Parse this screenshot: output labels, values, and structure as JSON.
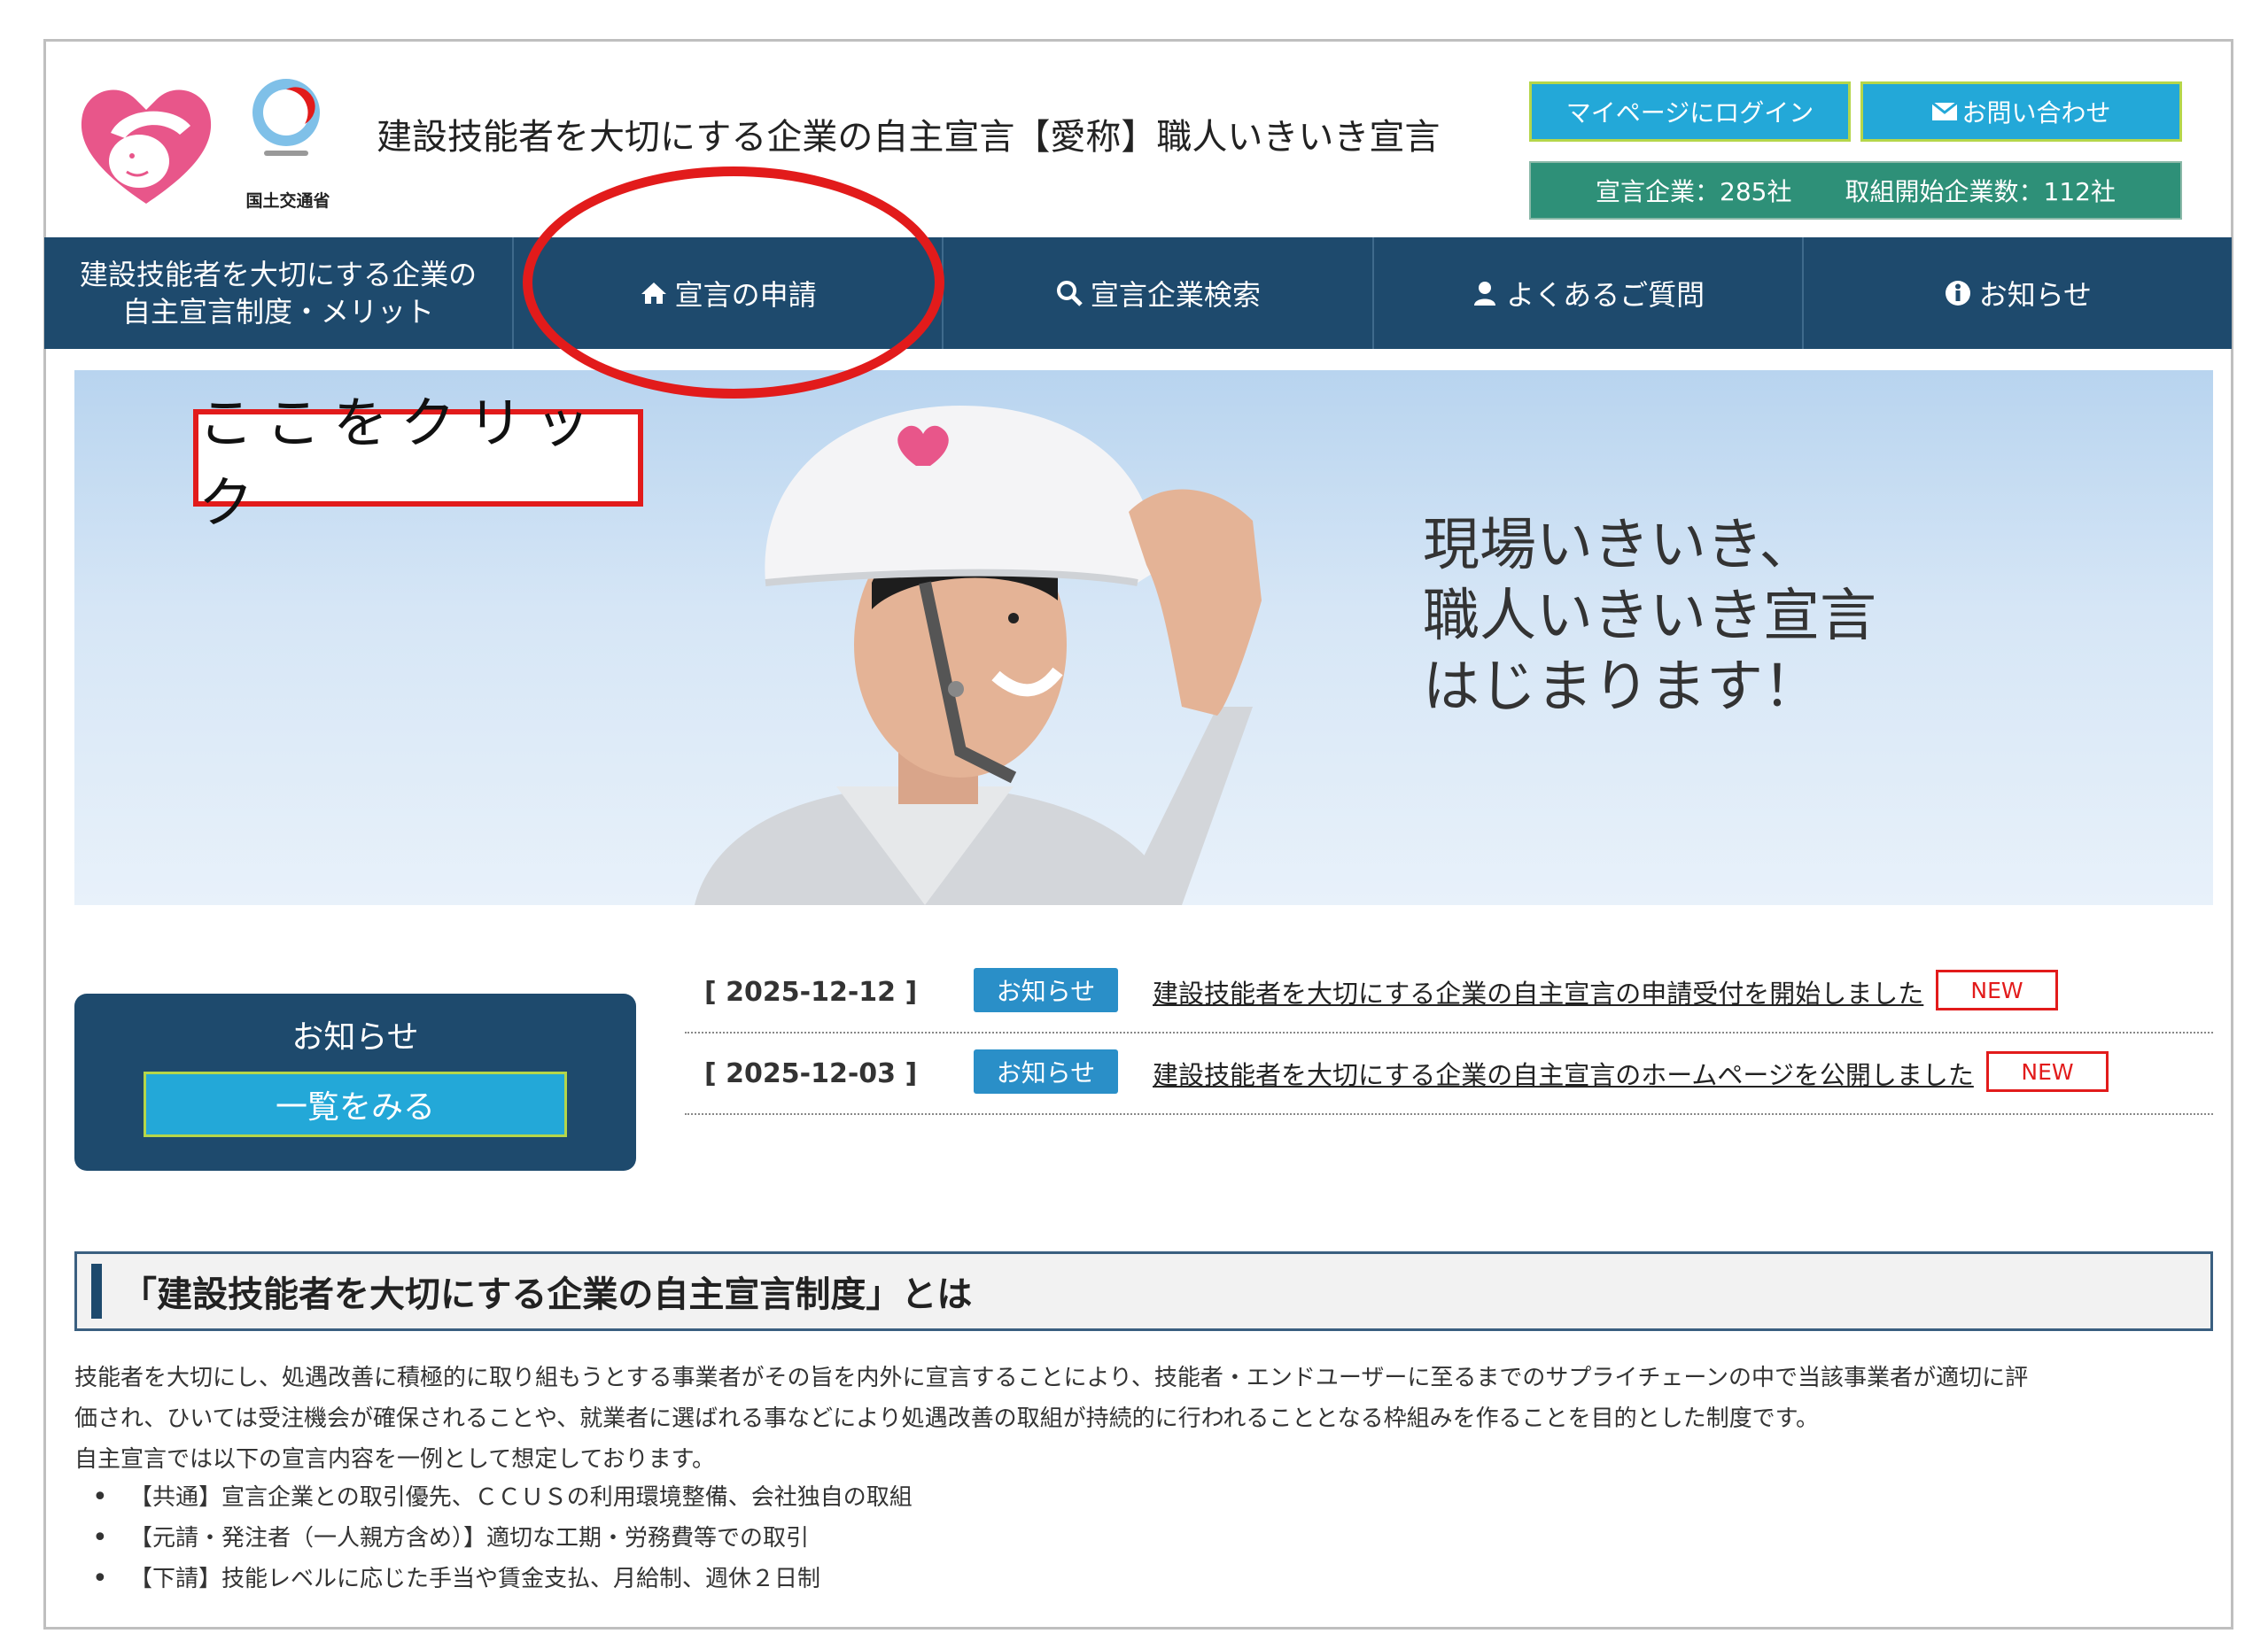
{
  "header": {
    "ministry_label": "国土交通省",
    "site_title": "建設技能者を大切にする企業の自主宣言【愛称】職人いきいき宣言",
    "login_button": "マイページにログイン",
    "contact_button": "お問い合わせ",
    "declared_companies": "宣言企業：285社",
    "started_companies": "取組開始企業数：112社"
  },
  "nav": {
    "items": [
      {
        "label": "建設技能者を大切にする企業の",
        "label2": "自主宣言制度・メリット"
      },
      {
        "label": "宣言の申請",
        "icon": "home-icon"
      },
      {
        "label": "宣言企業検索",
        "icon": "search-icon"
      },
      {
        "label": "よくあるご質問",
        "icon": "user-icon"
      },
      {
        "label": "お知らせ",
        "icon": "info-icon"
      }
    ]
  },
  "hero": {
    "line1": "現場いきいき、",
    "line2": "職人いきいき宣言",
    "line3": "はじまります！"
  },
  "annotation": {
    "click_here": "ここをクリック"
  },
  "news_panel": {
    "title": "お知らせ",
    "button": "一覧をみる"
  },
  "news": [
    {
      "date": "[ 2025-12-12 ]",
      "tag": "お知らせ",
      "title": "建設技能者を大切にする企業の自主宣言の申請受付を開始しました",
      "badge": "NEW"
    },
    {
      "date": "[ 2025-12-03 ]",
      "tag": "お知らせ",
      "title": "建設技能者を大切にする企業の自主宣言のホームページを公開しました",
      "badge": "NEW"
    }
  ],
  "section": {
    "title": "「建設技能者を大切にする企業の自主宣言制度」とは",
    "para1": "技能者を大切にし、処遇改善に積極的に取り組もうとする事業者がその旨を内外に宣言することにより、技能者・エンドユーザーに至るまでのサプライチェーンの中で当該事業者が適切に評",
    "para2": "価され、ひいては受注機会が確保されることや、就業者に選ばれる事などにより処遇改善の取組が持続的に行われることとなる枠組みを作ることを目的とした制度です。",
    "para3": "自主宣言では以下の宣言内容を一例として想定しております。",
    "bullets": [
      "【共通】宣言企業との取引優先、ＣＣＵＳの利用環境整備、会社独自の取組",
      "【元請・発注者（一人親方含め）】適切な工期・労務費等での取引",
      "【下請】技能レベルに応じた手当や賃金支払、月給制、週休２日制"
    ]
  }
}
